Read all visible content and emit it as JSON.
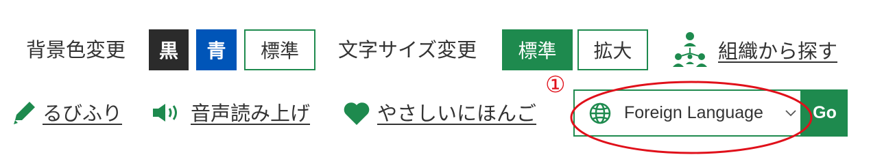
{
  "background_color": {
    "label": "背景色変更",
    "options": [
      "黒",
      "青",
      "標準"
    ]
  },
  "font_size": {
    "label": "文字サイズ変更",
    "options": [
      "標準",
      "拡大"
    ]
  },
  "org_search": {
    "label": "組織から探す",
    "icon": "organization-icon"
  },
  "tools": {
    "furigana": {
      "label": "るびふり",
      "icon": "pencil-icon"
    },
    "speech": {
      "label": "音声読み上げ",
      "icon": "speaker-icon"
    },
    "easy_japanese": {
      "label": "やさしいにほんご",
      "icon": "heart-icon"
    }
  },
  "language": {
    "selected": "Foreign Language",
    "icon": "globe-icon",
    "go_label": "Go"
  },
  "annotation": {
    "marker": "①",
    "color": "#e0101a"
  },
  "colors": {
    "green": "#1e8a4e",
    "blue": "#0055b8",
    "black": "#2b2b2b",
    "text": "#333333"
  }
}
